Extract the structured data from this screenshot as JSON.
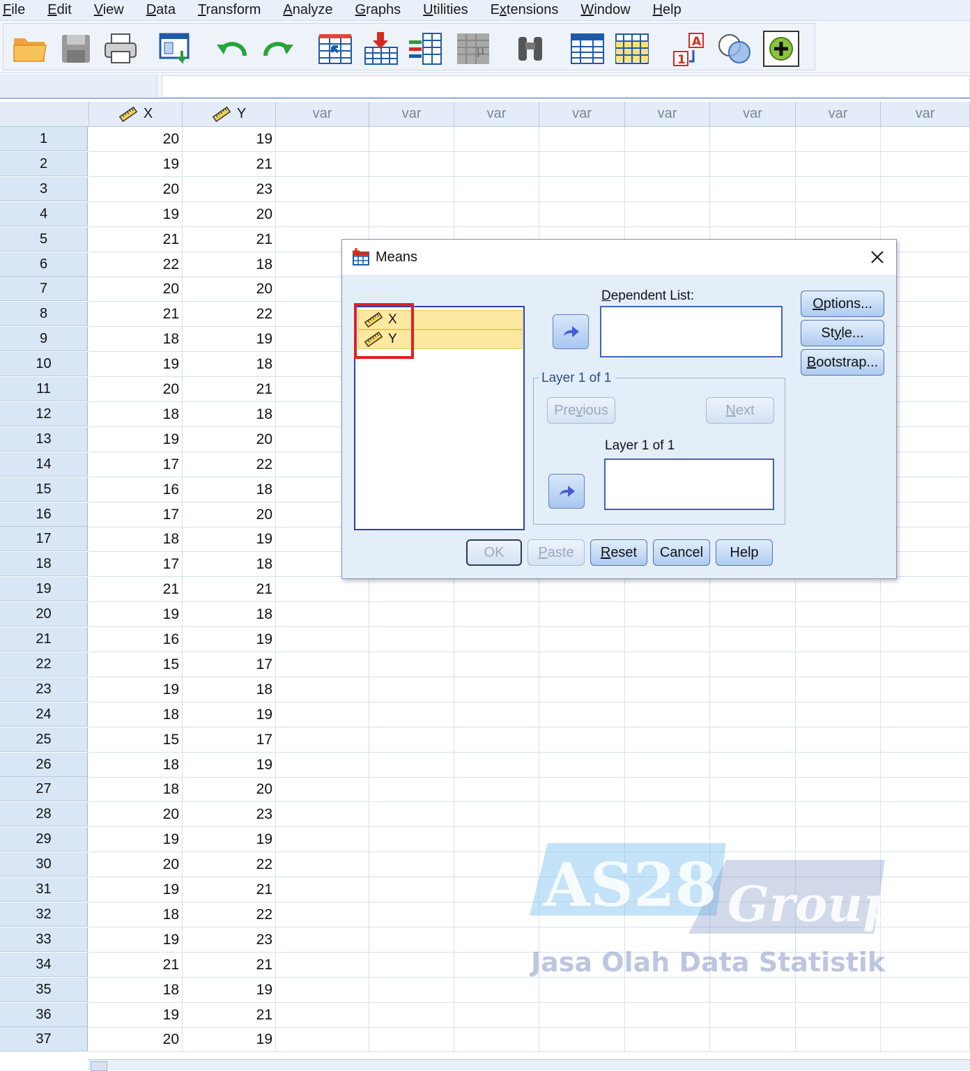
{
  "menu": [
    {
      "pre": "",
      "ul": "F",
      "post": "ile"
    },
    {
      "pre": "",
      "ul": "E",
      "post": "dit"
    },
    {
      "pre": "",
      "ul": "V",
      "post": "iew"
    },
    {
      "pre": "",
      "ul": "D",
      "post": "ata"
    },
    {
      "pre": "",
      "ul": "T",
      "post": "ransform"
    },
    {
      "pre": "",
      "ul": "A",
      "post": "nalyze"
    },
    {
      "pre": "",
      "ul": "G",
      "post": "raphs"
    },
    {
      "pre": "",
      "ul": "U",
      "post": "tilities"
    },
    {
      "pre": "E",
      "ul": "x",
      "post": "tensions"
    },
    {
      "pre": "",
      "ul": "W",
      "post": "indow"
    },
    {
      "pre": "",
      "ul": "H",
      "post": "elp"
    }
  ],
  "toolbar_icons": [
    "open-folder-icon",
    "save-icon",
    "print-icon",
    "dialog-recall-icon",
    "undo-icon",
    "redo-icon",
    "goto-case-icon",
    "goto-variable-icon",
    "variables-icon",
    "run-descriptives-icon",
    "find-icon",
    "insert-cases-icon",
    "insert-variable-icon",
    "split-file-icon",
    "value-labels-icon",
    "use-sets-icon",
    "extension-icon"
  ],
  "grid": {
    "columns": [
      "X",
      "Y",
      "var",
      "var",
      "var",
      "var",
      "var",
      "var",
      "var",
      "var"
    ],
    "rows": [
      [
        1,
        20,
        19
      ],
      [
        2,
        19,
        21
      ],
      [
        3,
        20,
        23
      ],
      [
        4,
        19,
        20
      ],
      [
        5,
        21,
        21
      ],
      [
        6,
        22,
        18
      ],
      [
        7,
        20,
        20
      ],
      [
        8,
        21,
        22
      ],
      [
        9,
        18,
        19
      ],
      [
        10,
        19,
        18
      ],
      [
        11,
        20,
        21
      ],
      [
        12,
        18,
        18
      ],
      [
        13,
        19,
        20
      ],
      [
        14,
        17,
        22
      ],
      [
        15,
        16,
        18
      ],
      [
        16,
        17,
        20
      ],
      [
        17,
        18,
        19
      ],
      [
        18,
        17,
        18
      ],
      [
        19,
        21,
        21
      ],
      [
        20,
        19,
        18
      ],
      [
        21,
        16,
        19
      ],
      [
        22,
        15,
        17
      ],
      [
        23,
        19,
        18
      ],
      [
        24,
        18,
        19
      ],
      [
        25,
        15,
        17
      ],
      [
        26,
        18,
        19
      ],
      [
        27,
        18,
        20
      ],
      [
        28,
        20,
        23
      ],
      [
        29,
        19,
        19
      ],
      [
        30,
        20,
        22
      ],
      [
        31,
        19,
        21
      ],
      [
        32,
        18,
        22
      ],
      [
        33,
        19,
        23
      ],
      [
        34,
        21,
        21
      ],
      [
        35,
        18,
        19
      ],
      [
        36,
        19,
        21
      ],
      [
        37,
        20,
        19
      ]
    ]
  },
  "dialog": {
    "title": "Means",
    "source_vars": [
      "X",
      "Y"
    ],
    "dependent_label": {
      "ul": "D",
      "post": "ependent List:"
    },
    "layer_group_title": "Layer 1 of 1",
    "layer_label": "Layer 1 of 1",
    "previous": {
      "pre": "Pre",
      "ul": "v",
      "post": "ious"
    },
    "next": {
      "pre": "",
      "ul": "N",
      "post": "ext"
    },
    "options": {
      "pre": "",
      "ul": "O",
      "post": "ptions..."
    },
    "style": {
      "pre": "St",
      "ul": "y",
      "post": "le..."
    },
    "bootstrap": {
      "pre": "",
      "ul": "B",
      "post": "ootstrap..."
    },
    "ok": "OK",
    "paste": {
      "pre": "",
      "ul": "P",
      "post": "aste"
    },
    "reset": {
      "pre": "",
      "ul": "R",
      "post": "eset"
    },
    "cancel": "Cancel",
    "help": "Help"
  },
  "watermark": {
    "brand1": "AS28",
    "brand2": "Group",
    "tagline": "Jasa Olah Data Statistika"
  }
}
